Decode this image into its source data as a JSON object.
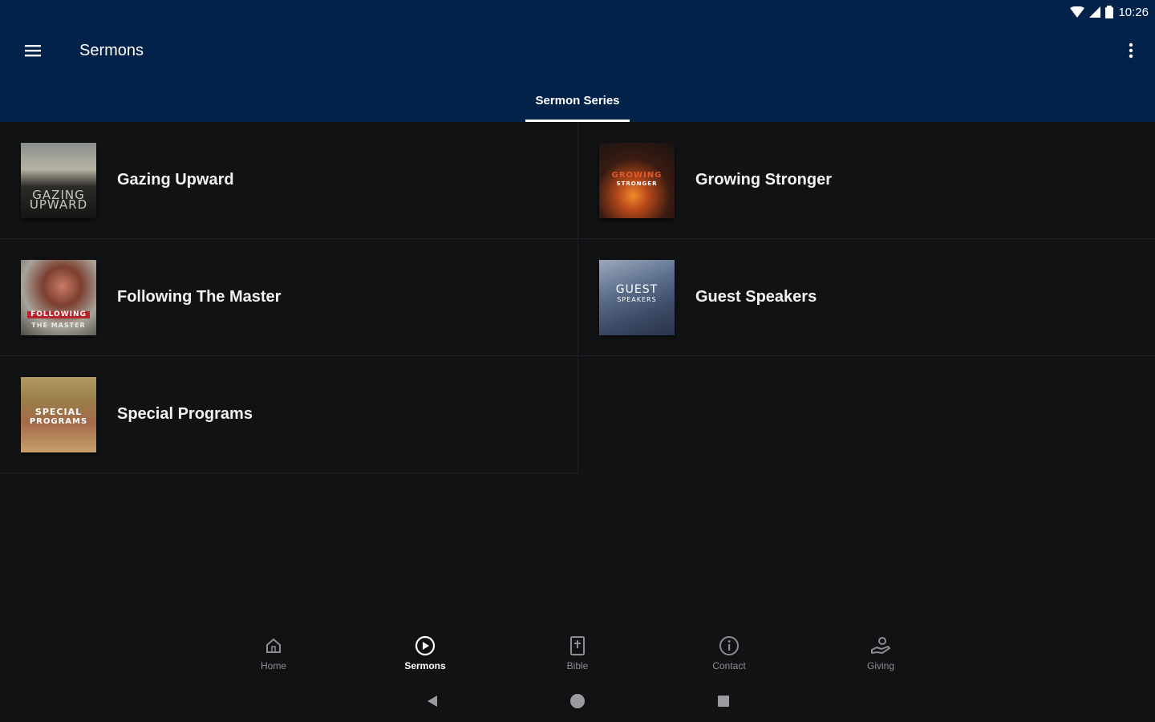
{
  "status_bar": {
    "time": "10:26"
  },
  "toolbar": {
    "title": "Sermons"
  },
  "tabs": [
    {
      "label": "Sermon Series",
      "active": true
    }
  ],
  "series": [
    {
      "title": "Gazing Upward",
      "thumb_text": [
        "GAZING",
        "UPWARD"
      ]
    },
    {
      "title": "Growing Stronger",
      "thumb_text": [
        "GROWING",
        "STRONGER"
      ]
    },
    {
      "title": "Following The Master",
      "thumb_text": [
        "FOLLOWING",
        "THE MASTER"
      ]
    },
    {
      "title": "Guest Speakers",
      "thumb_text": [
        "GUEST",
        "SPEAKERS"
      ]
    },
    {
      "title": "Special Programs",
      "thumb_text": [
        "SPECIAL",
        "PROGRAMS"
      ]
    }
  ],
  "bottom_nav": [
    {
      "label": "Home",
      "icon": "home-icon",
      "active": false
    },
    {
      "label": "Sermons",
      "icon": "play-circle-icon",
      "active": true
    },
    {
      "label": "Bible",
      "icon": "bible-icon",
      "active": false
    },
    {
      "label": "Contact",
      "icon": "info-icon",
      "active": false
    },
    {
      "label": "Giving",
      "icon": "giving-hand-icon",
      "active": false
    }
  ],
  "colors": {
    "appbar": "#03224a",
    "background": "#111214",
    "nav_inactive": "#8b8d91",
    "nav_active": "#ffffff"
  }
}
